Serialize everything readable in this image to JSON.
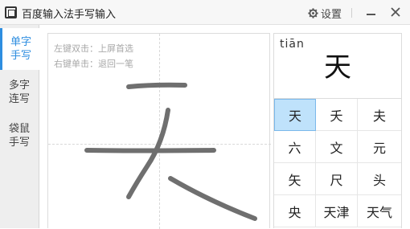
{
  "window": {
    "title": "百度输入法手写输入",
    "settings_label": "设置",
    "icons": [
      "app-logo-icon",
      "gear-icon",
      "minimize-icon",
      "close-icon"
    ]
  },
  "tabs": [
    {
      "line1": "单字",
      "line2": "手写",
      "active": true
    },
    {
      "line1": "多字",
      "line2": "连写",
      "active": false
    },
    {
      "line1": "袋鼠",
      "line2": "手写",
      "active": false
    }
  ],
  "pad": {
    "hint_double_click": "左键双击：上屏首选",
    "hint_right_click": "右键单击：退回一笔"
  },
  "preview": {
    "pinyin": "tiān",
    "character": "天"
  },
  "candidates": [
    [
      "天",
      "夭",
      "夫"
    ],
    [
      "六",
      "文",
      "元"
    ],
    [
      "矢",
      "尺",
      "头"
    ],
    [
      "央",
      "天津",
      "天气"
    ]
  ],
  "colors": {
    "accent": "#2e8ee0",
    "selected_bg": "#bfe2fb",
    "stroke": "#6f6f6f"
  }
}
